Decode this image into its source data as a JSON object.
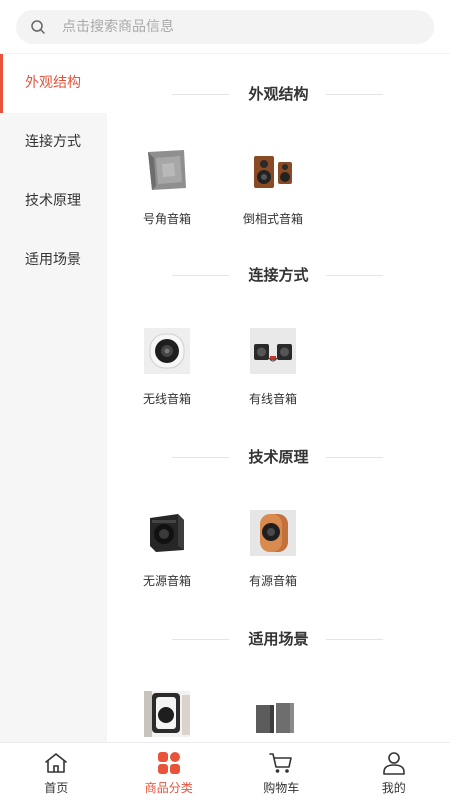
{
  "search": {
    "placeholder": "点击搜索商品信息"
  },
  "sidebar": {
    "items": [
      {
        "label": "外观结构",
        "active": true
      },
      {
        "label": "连接方式",
        "active": false
      },
      {
        "label": "技术原理",
        "active": false
      },
      {
        "label": "适用场景",
        "active": false
      }
    ]
  },
  "sections": [
    {
      "title": "外观结构",
      "items": [
        {
          "label": "号角音箱",
          "icon": "horn-speaker-icon"
        },
        {
          "label": "倒相式音箱",
          "icon": "bass-reflex-speaker-icon"
        }
      ]
    },
    {
      "title": "连接方式",
      "items": [
        {
          "label": "无线音箱",
          "icon": "wireless-speaker-icon"
        },
        {
          "label": "有线音箱",
          "icon": "wired-speaker-icon"
        }
      ]
    },
    {
      "title": "技术原理",
      "items": [
        {
          "label": "无源音箱",
          "icon": "passive-speaker-icon"
        },
        {
          "label": "有源音箱",
          "icon": "active-speaker-icon"
        }
      ]
    },
    {
      "title": "适用场景",
      "items": [
        {
          "label": "",
          "icon": "desktop-speaker-icon"
        },
        {
          "label": "",
          "icon": "bookshelf-speaker-icon"
        }
      ]
    }
  ],
  "tabbar": {
    "items": [
      {
        "label": "首页",
        "icon": "home-icon",
        "active": false
      },
      {
        "label": "商品分类",
        "icon": "category-icon",
        "active": true
      },
      {
        "label": "购物车",
        "icon": "cart-icon",
        "active": false
      },
      {
        "label": "我的",
        "icon": "user-icon",
        "active": false
      }
    ]
  },
  "colors": {
    "accent": "#e8533a",
    "text": "#333333",
    "sidebar_bg": "#f6f6f6",
    "search_bg": "#f3f3f3"
  }
}
